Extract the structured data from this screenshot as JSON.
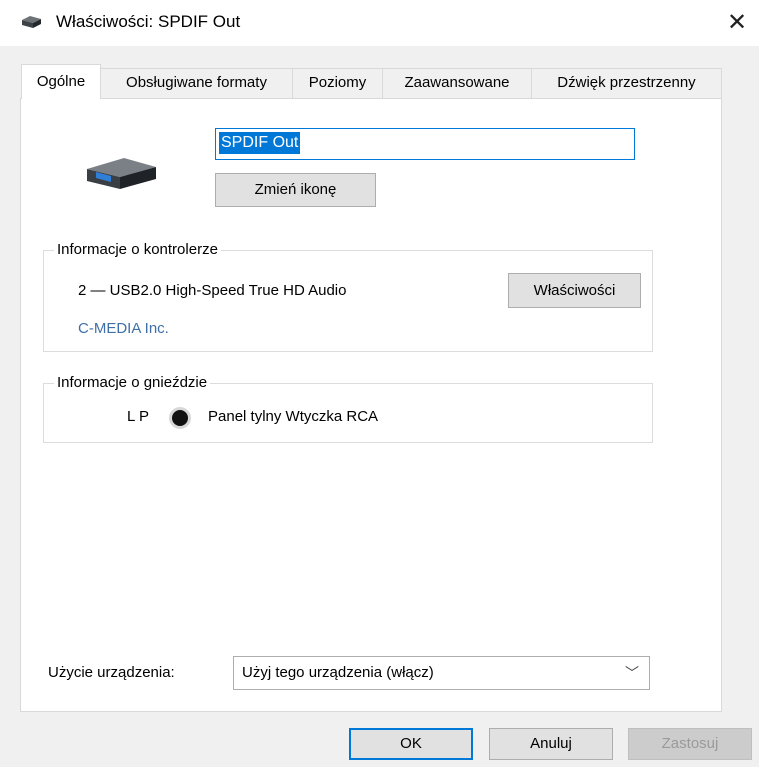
{
  "window": {
    "title": "Właściwości: SPDIF Out",
    "close_icon": "close-icon",
    "title_icon": "speaker-device-icon"
  },
  "tabs": [
    {
      "label": "Ogólne",
      "active": true
    },
    {
      "label": "Obsługiwane formaty",
      "active": false
    },
    {
      "label": "Poziomy",
      "active": false
    },
    {
      "label": "Zaawansowane",
      "active": false
    },
    {
      "label": "Dźwięk przestrzenny",
      "active": false
    }
  ],
  "general": {
    "device_name_value": "SPDIF Out",
    "change_icon_label": "Zmień ikonę"
  },
  "controller": {
    "legend": "Informacje o kontrolerze",
    "name": "2 — USB2.0 High-Speed True HD Audio",
    "vendor": "C-MEDIA Inc.",
    "properties_label": "Właściwości"
  },
  "jack": {
    "legend": "Informacje o gnieździe",
    "channels": "L P",
    "description": "Panel tylny Wtyczka RCA"
  },
  "usage": {
    "label": "Użycie urządzenia:",
    "selected": "Użyj tego urządzenia (włącz)"
  },
  "buttons": {
    "ok": "OK",
    "cancel": "Anuluj",
    "apply": "Zastosuj"
  },
  "colors": {
    "accent": "#0078d7",
    "vendor_text": "#3f6fa8",
    "disabled_text": "#9a9a9a"
  }
}
